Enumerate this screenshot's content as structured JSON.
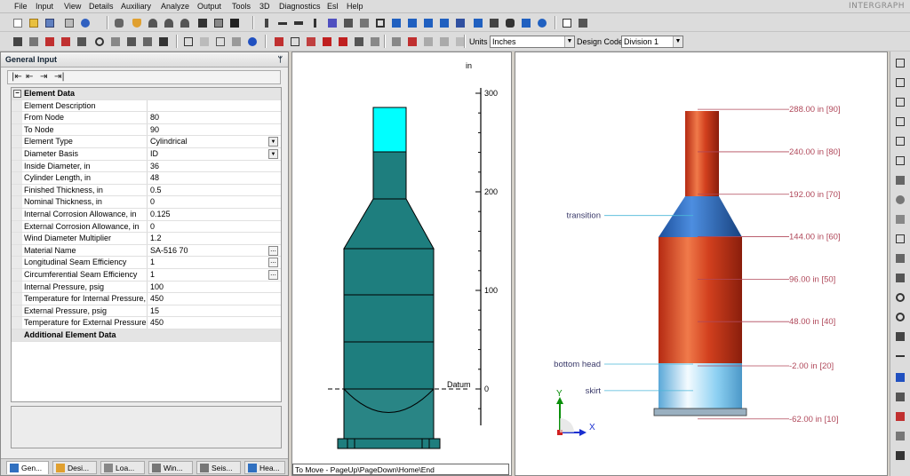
{
  "menu": [
    "File",
    "Input",
    "View",
    "Details",
    "Auxiliary",
    "Analyze",
    "Output",
    "Tools",
    "3D",
    "Diagnostics",
    "Esl",
    "Help"
  ],
  "brand": "INTERGRAPH",
  "toolbar": {
    "units_label": "Units",
    "units_value": "Inches",
    "design_code_label": "Design Code",
    "design_code_value": "Division 1"
  },
  "panel": {
    "title": "General Input",
    "nav_buttons": [
      "|⇤",
      "⇤",
      "⇥",
      "⇥|"
    ],
    "section_header": "Element Data",
    "rows": [
      {
        "label": "Element Description",
        "value": ""
      },
      {
        "label": "From Node",
        "value": "80"
      },
      {
        "label": "To Node",
        "value": "90"
      },
      {
        "label": "Element Type",
        "value": "Cylindrical",
        "control": "dropdown"
      },
      {
        "label": "Diameter Basis",
        "value": "ID",
        "control": "dropdown"
      },
      {
        "label": "Inside Diameter, in",
        "value": "36"
      },
      {
        "label": "Cylinder Length, in",
        "value": "48"
      },
      {
        "label": "Finished Thickness, in",
        "value": "0.5"
      },
      {
        "label": "Nominal Thickness,  in",
        "value": "0"
      },
      {
        "label": "Internal Corrosion Allowance,  in",
        "value": "0.125"
      },
      {
        "label": "External Corrosion Allowance,  in",
        "value": "0"
      },
      {
        "label": "Wind Diameter Multiplier",
        "value": "1.2"
      },
      {
        "label": "Material Name",
        "value": "SA-516 70",
        "control": "ellipsis"
      },
      {
        "label": "Longitudinal Seam Efficiency",
        "value": "1",
        "control": "ellipsis"
      },
      {
        "label": "Circumferential Seam Efficiency",
        "value": "1",
        "control": "ellipsis"
      },
      {
        "label": "Internal Pressure,  psig",
        "value": "100"
      },
      {
        "label": "Temperature for Internal Pressure,",
        "value": "450"
      },
      {
        "label": "External Pressure,  psig",
        "value": "15"
      },
      {
        "label": "Temperature for External Pressure,",
        "value": "450"
      }
    ],
    "additional_header": "Additional Element Data",
    "tabs": [
      "Gen...",
      "Desi...",
      "Loa...",
      "Win...",
      "Seis...",
      "Hea..."
    ]
  },
  "center_view": {
    "unit": "in",
    "ruler_ticks": [
      "300",
      "200",
      "100",
      "0"
    ],
    "ruler_values": [
      300,
      200,
      100,
      0
    ],
    "datum_label": "Datum",
    "status": "To Move - PageUp\\PageDown\\Home\\End",
    "colors": {
      "body": "#1e7e7e",
      "selected": "#00ffff"
    }
  },
  "right_view": {
    "elevations": [
      {
        "value": 288,
        "label": "288.00 in  [90]"
      },
      {
        "value": 240,
        "label": "240.00 in  [80]"
      },
      {
        "value": 192,
        "label": "192.00 in  [70]"
      },
      {
        "value": 144,
        "label": "144.00 in  [60]"
      },
      {
        "value": 96,
        "label": "96.00 in  [50]"
      },
      {
        "value": 48,
        "label": "48.00 in  [40]"
      },
      {
        "value": -2,
        "label": "-2.00 in  [20]"
      },
      {
        "value": -62,
        "label": "-62.00 in  [10]"
      }
    ],
    "callouts": [
      {
        "label": "transition",
        "elevation": 168
      },
      {
        "label": "bottom head",
        "elevation": 0
      },
      {
        "label": "skirt",
        "elevation": -30
      }
    ],
    "axis_labels": {
      "y": "Y",
      "x": "X"
    },
    "colors": {
      "shell": "#d2401e",
      "transition": "#2a6fc4",
      "skirt": "#7ec8ef",
      "dimension": "#b0485a"
    }
  }
}
